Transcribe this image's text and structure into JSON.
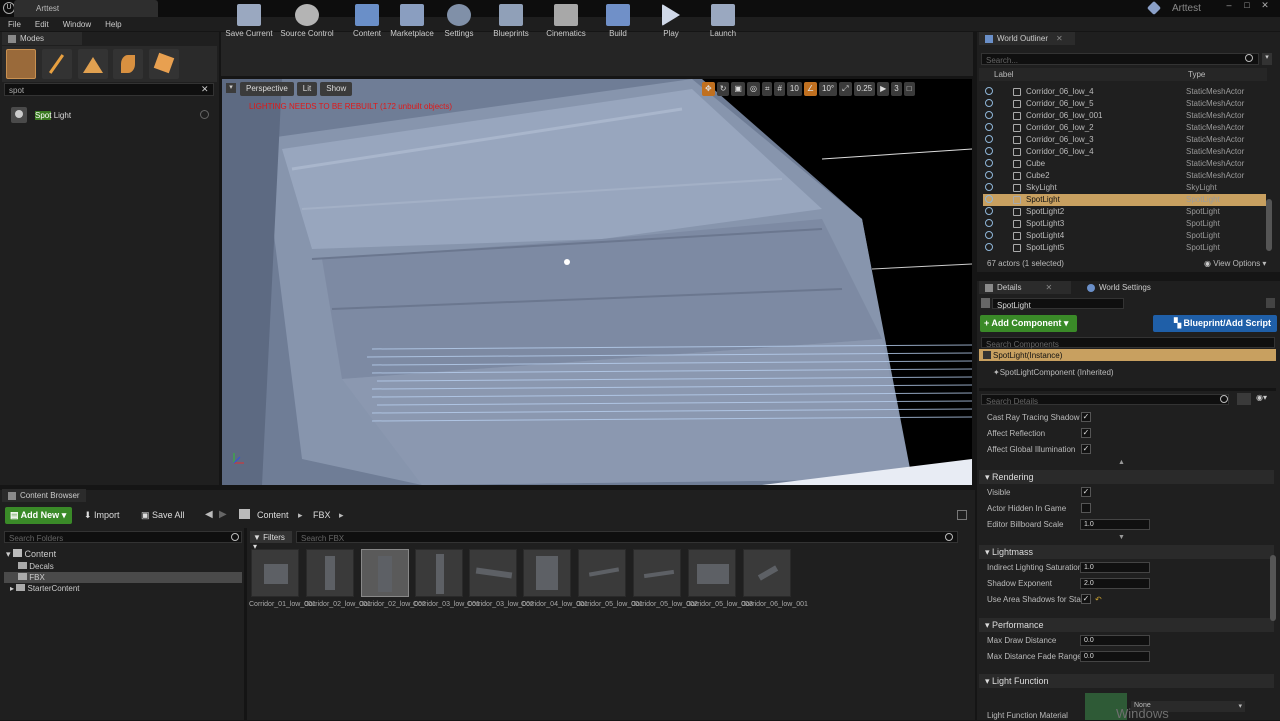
{
  "window": {
    "tab_title": "Arttest",
    "project_name": "Arttest",
    "logo_letter": "U",
    "min": "–",
    "max": "□",
    "close": "✕"
  },
  "menu": [
    "File",
    "Edit",
    "Window",
    "Help"
  ],
  "modes": {
    "tab_label": "Modes",
    "search_value": "spot",
    "result_label": "Spot Light"
  },
  "toolbar": {
    "buttons": [
      "Save Current",
      "Source Control",
      "Content",
      "Marketplace",
      "Settings",
      "Blueprints",
      "Cinematics",
      "Build",
      "Play",
      "Launch"
    ]
  },
  "viewport": {
    "perspective": "Perspective",
    "lit": "Lit",
    "show": "Show",
    "warning": "LIGHTING NEEDS TO BE REBUILT (172 unbuilt objects)",
    "grid_value": "10",
    "angle_value": "10°",
    "scale_value": "0.25",
    "cam_speed": "3"
  },
  "outliner": {
    "tab_label": "World Outliner",
    "search_placeholder": "Search...",
    "col_label": "Label",
    "col_type": "Type",
    "rows": [
      {
        "label": "Corridor_06_low_4",
        "type": "StaticMeshActor"
      },
      {
        "label": "Corridor_06_low_5",
        "type": "StaticMeshActor"
      },
      {
        "label": "Corridor_06_low_001",
        "type": "StaticMeshActor"
      },
      {
        "label": "Corridor_06_low_2",
        "type": "StaticMeshActor"
      },
      {
        "label": "Corridor_06_low_3",
        "type": "StaticMeshActor"
      },
      {
        "label": "Corridor_06_low_4",
        "type": "StaticMeshActor"
      },
      {
        "label": "Cube",
        "type": "StaticMeshActor"
      },
      {
        "label": "Cube2",
        "type": "StaticMeshActor"
      },
      {
        "label": "SkyLight",
        "type": "SkyLight"
      },
      {
        "label": "SpotLight",
        "type": "SpotLight"
      },
      {
        "label": "SpotLight2",
        "type": "SpotLight"
      },
      {
        "label": "SpotLight3",
        "type": "SpotLight"
      },
      {
        "label": "SpotLight4",
        "type": "SpotLight"
      },
      {
        "label": "SpotLight5",
        "type": "SpotLight"
      }
    ],
    "selected_index": 9,
    "status": "67 actors (1 selected)",
    "view_options": "View Options"
  },
  "details": {
    "tab_label": "Details",
    "world_settings": "World Settings",
    "name_value": "SpotLight",
    "add_component": "+ Add Component",
    "blueprint_btn": "Blueprint/Add Script",
    "search_components": "Search Components",
    "component_root": "SpotLight(Instance)",
    "component_child": "SpotLightComponent (Inherited)",
    "search_details": "Search Details",
    "props_top": [
      {
        "label": "Cast Ray Tracing Shadow",
        "checked": true
      },
      {
        "label": "Affect Reflection",
        "checked": true
      },
      {
        "label": "Affect Global Illumination",
        "checked": true
      }
    ],
    "rendering": {
      "header": "Rendering",
      "visible": "Visible",
      "hidden_in_game": "Actor Hidden In Game",
      "billboard_scale": "Editor Billboard Scale",
      "billboard_value": "1.0"
    },
    "lightmass": {
      "header": "Lightmass",
      "indirect_sat": "Indirect Lighting Saturation",
      "indirect_value": "1.0",
      "shadow_exp": "Shadow Exponent",
      "shadow_value": "2.0",
      "area_shadows": "Use Area Shadows for Stat"
    },
    "performance": {
      "header": "Performance",
      "max_draw": "Max Draw Distance",
      "max_draw_value": "0.0",
      "fade_range": "Max Distance Fade Range",
      "fade_value": "0.0"
    },
    "light_function": {
      "header": "Light Function",
      "material": "Light Function Material",
      "none": "None"
    }
  },
  "content_browser": {
    "tab_label": "Content Browser",
    "add_new": "Add New",
    "import": "Import",
    "save_all": "Save All",
    "path_root": "Content",
    "path_child": "FBX",
    "search_folders": "Search Folders",
    "filters": "Filters",
    "search_fbx": "Search FBX",
    "tree": [
      "Content",
      "Decals",
      "FBX",
      "StarterContent"
    ],
    "assets": [
      "Corridor_01_low_001",
      "Corridor_02_low_001",
      "Corridor_02_low_002",
      "Corridor_03_low_001",
      "Corridor_03_low_002",
      "Corridor_04_low_001",
      "Corridor_05_low_001",
      "Corridor_05_low_002",
      "Corridor_05_low_003",
      "Corridor_06_low_001"
    ]
  },
  "watermark": "Windows"
}
